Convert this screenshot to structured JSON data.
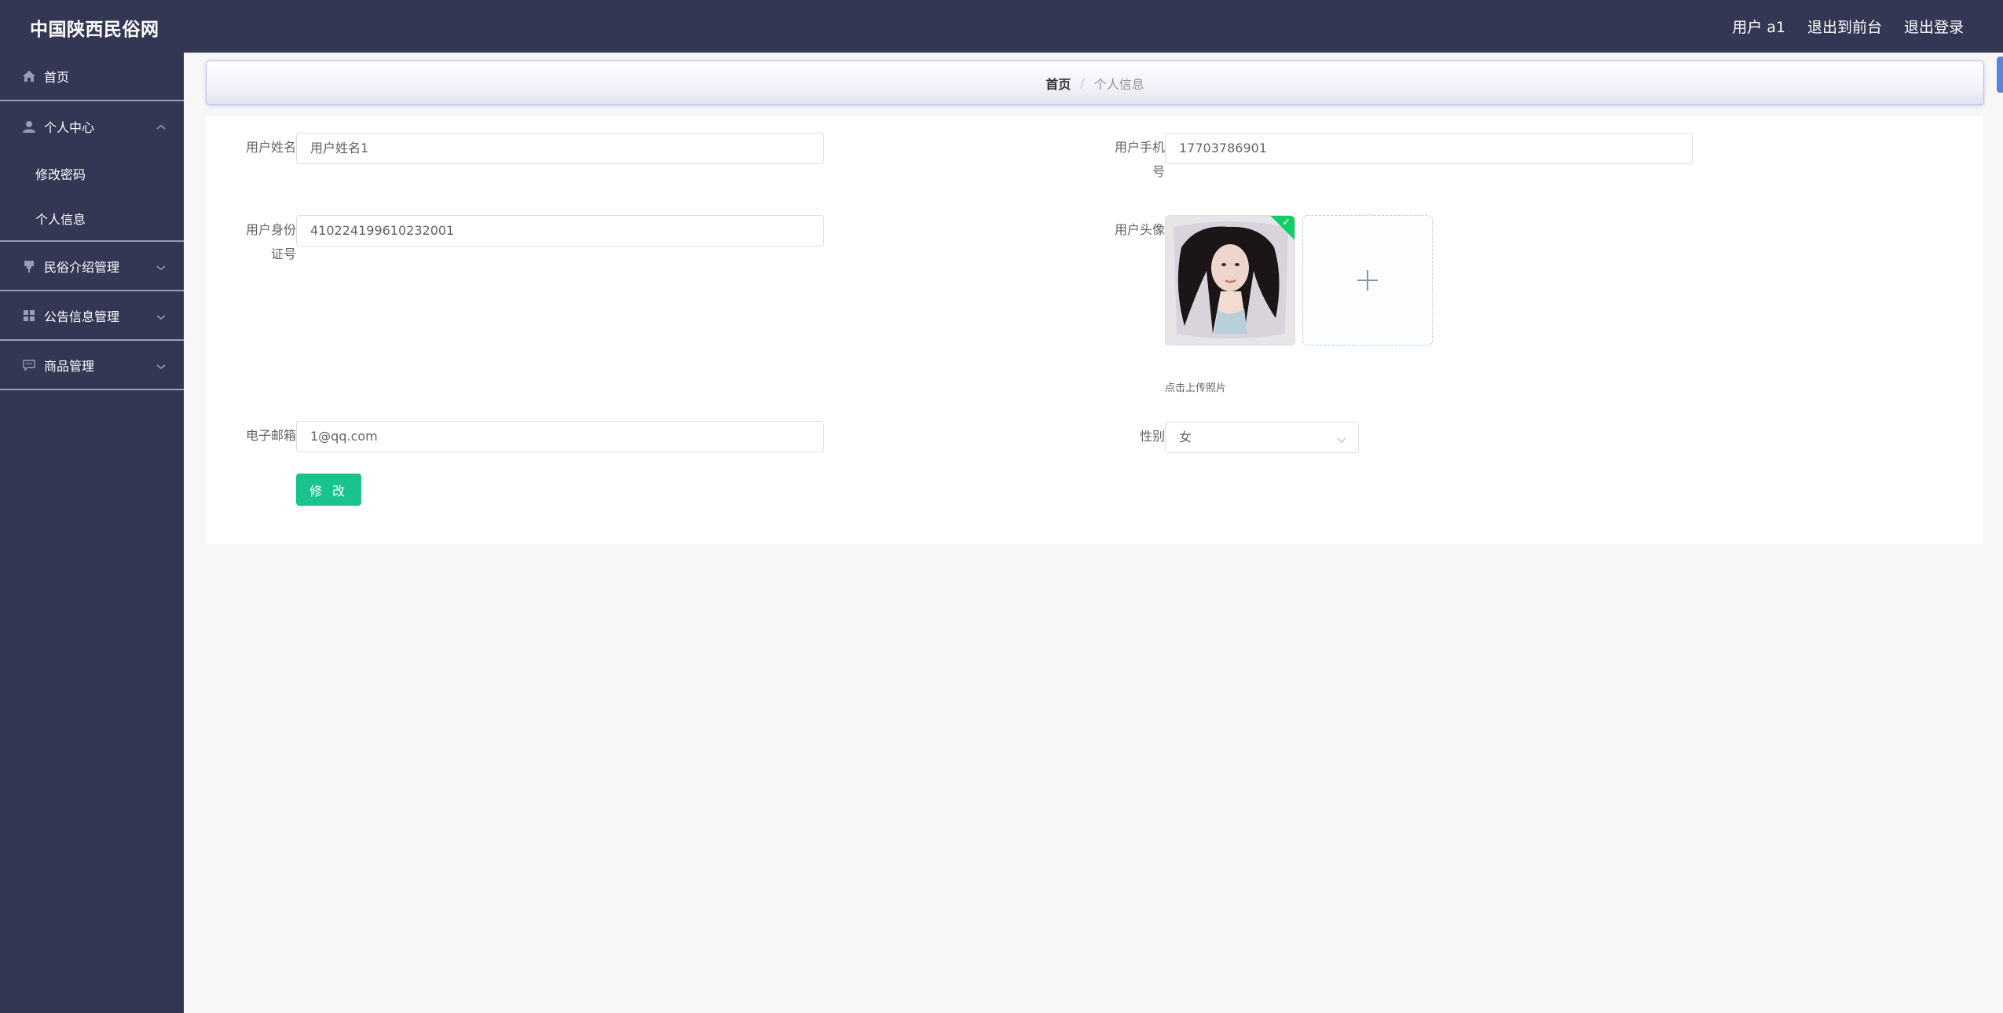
{
  "app": {
    "brand": "中国陕西民俗网",
    "user_label": "用户 a1",
    "back_to_front": "退出到前台",
    "logout": "退出登录"
  },
  "sidebar": {
    "home": "首页",
    "center": "个人中心",
    "change_password": "修改密码",
    "personal_info": "个人信息",
    "folk_manage": "民俗介绍管理",
    "notice_manage": "公告信息管理",
    "goods_manage": "商品管理"
  },
  "breadcrumb": {
    "home": "首页",
    "separator": "/",
    "current": "个人信息"
  },
  "form": {
    "name_label": "用户姓名",
    "name_value": "用户姓名1",
    "phone_label_line1": "用户手机",
    "phone_label_line2": "号",
    "phone_value": "17703786901",
    "id_label_line1": "用户身份",
    "id_label_line2": "证号",
    "id_value": "410224199610232001",
    "avatar_label": "用户头像",
    "upload_tip": "点击上传照片",
    "email_label": "电子邮箱",
    "email_value": "1@qq.com",
    "gender_label": "性别",
    "gender_value": "女",
    "submit_label": "修 改"
  },
  "colors": {
    "nav_bg": "#333754",
    "accent_button": "#19c38e",
    "upload_success": "#13ce66"
  },
  "icons": {
    "home": "home-icon",
    "user": "user-icon",
    "folk": "flag-icon",
    "notice": "grid-icon",
    "goods": "chat-icon",
    "plus": "plus-icon",
    "chevron": "chevron-down-icon"
  }
}
